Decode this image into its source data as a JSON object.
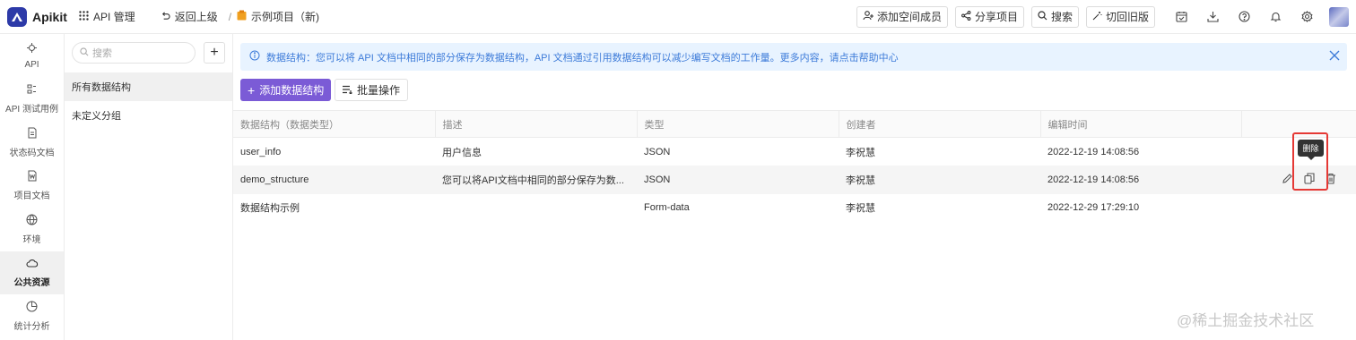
{
  "app": {
    "name": "Apikit"
  },
  "topnav": {
    "api_manage": "API 管理",
    "back": "返回上级",
    "separator": "/",
    "project": "示例项目（新)"
  },
  "topright": {
    "add_member": "添加空间成员",
    "share": "分享项目",
    "search": "搜索",
    "switch_old": "切回旧版",
    "icons": [
      "calendar-check-icon",
      "download-icon",
      "help-icon",
      "bell-icon",
      "gear-icon"
    ]
  },
  "sidebar": {
    "items": [
      {
        "label": "API",
        "icon": "api-icon"
      },
      {
        "label": "API 测试用例",
        "icon": "test-case-icon"
      },
      {
        "label": "状态码文档",
        "icon": "status-doc-icon"
      },
      {
        "label": "项目文档",
        "icon": "project-doc-icon"
      },
      {
        "label": "环境",
        "icon": "environment-icon"
      },
      {
        "label": "公共资源",
        "icon": "cloud-icon",
        "active": true
      },
      {
        "label": "统计分析",
        "icon": "pie-chart-icon"
      }
    ]
  },
  "groups": {
    "search_placeholder": "搜索",
    "items": [
      {
        "label": "所有数据结构",
        "active": true
      },
      {
        "label": "未定义分组"
      }
    ]
  },
  "banner": {
    "text": "数据结构：您可以将 API 文档中相同的部分保存为数据结构，API 文档通过引用数据结构可以减少编写文档的工作量。更多内容，请点击帮助中心"
  },
  "toolbar": {
    "add_label": "添加数据结构",
    "batch_label": "批量操作"
  },
  "table": {
    "headers": [
      "数据结构（数据类型）",
      "描述",
      "类型",
      "创建者",
      "编辑时间",
      ""
    ],
    "rows": [
      {
        "name": "user_info",
        "desc": "用户信息",
        "type": "JSON",
        "creator": "李祝慧",
        "time": "2022-12-19 14:08:56"
      },
      {
        "name": "demo_structure",
        "desc": "您可以将API文档中相同的部分保存为数...",
        "type": "JSON",
        "creator": "李祝慧",
        "time": "2022-12-19 14:08:56"
      },
      {
        "name": "数据结构示例",
        "desc": "",
        "type": "Form-data",
        "creator": "李祝慧",
        "time": "2022-12-29 17:29:10"
      }
    ]
  },
  "tooltip": {
    "text": "删除"
  },
  "watermark": {
    "text": "@稀土掘金技术社区"
  },
  "colors": {
    "brand": "#2d3aa8",
    "accent": "#7b5bd6",
    "banner_bg": "#e8f3ff",
    "banner_text": "#3d7bd9",
    "highlight": "#e53935"
  }
}
